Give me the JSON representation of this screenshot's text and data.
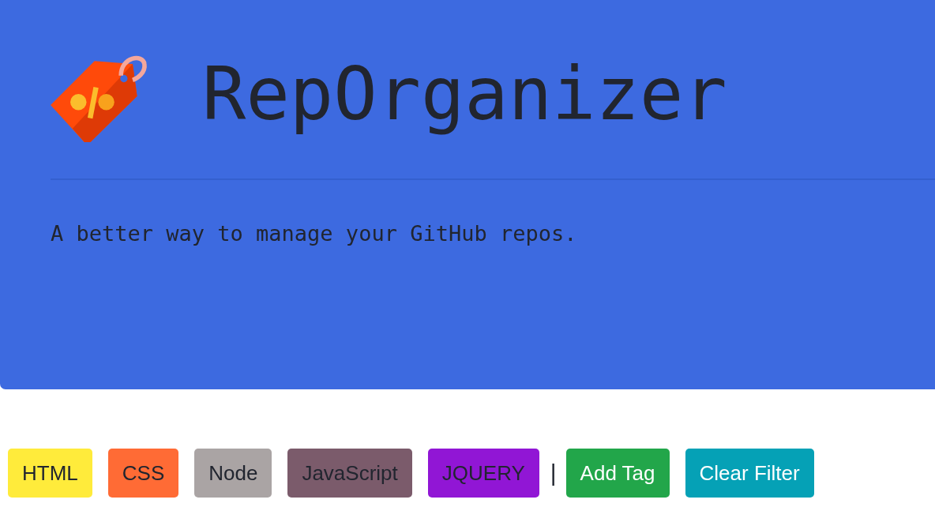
{
  "header": {
    "title": "RepOrganizer",
    "subtitle": "A better way to manage your GitHub repos."
  },
  "toolbar": {
    "tags": [
      {
        "label": "HTML",
        "color": "#ffeb3b"
      },
      {
        "label": "CSS",
        "color": "#ff6b35"
      },
      {
        "label": "Node",
        "color": "#aaa4a4"
      },
      {
        "label": "JavaScript",
        "color": "#7b5b6b"
      },
      {
        "label": "JQUERY",
        "color": "#9116d5"
      }
    ],
    "separator": "|",
    "buttons": [
      {
        "label": "Add Tag",
        "kind": "success"
      },
      {
        "label": "Clear Filter",
        "kind": "info"
      }
    ]
  }
}
